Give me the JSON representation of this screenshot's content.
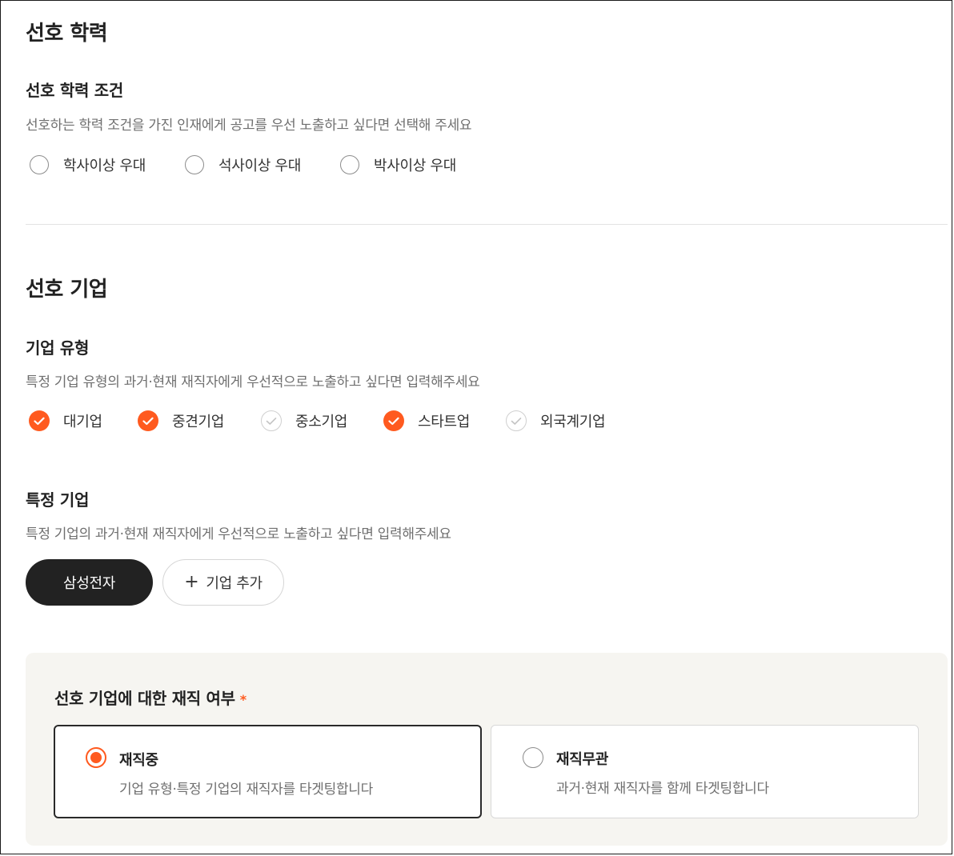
{
  "education": {
    "section_title": "선호 학력",
    "condition_title": "선호 학력 조건",
    "condition_desc": "선호하는 학력 조건을 가진 인재에게 공고를 우선 노출하고 싶다면 선택해 주세요",
    "options": [
      {
        "label": "학사이상 우대",
        "selected": false
      },
      {
        "label": "석사이상 우대",
        "selected": false
      },
      {
        "label": "박사이상 우대",
        "selected": false
      }
    ]
  },
  "company": {
    "section_title": "선호 기업",
    "type_title": "기업 유형",
    "type_desc": "특정 기업 유형의 과거·현재 재직자에게 우선적으로 노출하고 싶다면 입력해주세요",
    "types": [
      {
        "label": "대기업",
        "checked": true
      },
      {
        "label": "중견기업",
        "checked": true
      },
      {
        "label": "중소기업",
        "checked": false
      },
      {
        "label": "스타트업",
        "checked": true
      },
      {
        "label": "외국계기업",
        "checked": false
      }
    ],
    "specific_title": "특정 기업",
    "specific_desc": "특정 기업의 과거·현재 재직자에게 우선적으로 노출하고 싶다면 입력해주세요",
    "chips": [
      {
        "label": "삼성전자"
      }
    ],
    "add_button_label": "기업 추가"
  },
  "employment": {
    "title": "선호 기업에 대한 재직 여부",
    "required_mark": "*",
    "options": [
      {
        "title": "재직중",
        "desc": "기업 유형·특정 기업의 재직자를 타겟팅합니다",
        "selected": true
      },
      {
        "title": "재직무관",
        "desc": "과거·현재 재직자를 함께 타겟팅합니다",
        "selected": false
      }
    ]
  },
  "colors": {
    "accent": "#ff5a1f",
    "chip_dark": "#222222",
    "panel_bg": "#f6f5f1"
  }
}
